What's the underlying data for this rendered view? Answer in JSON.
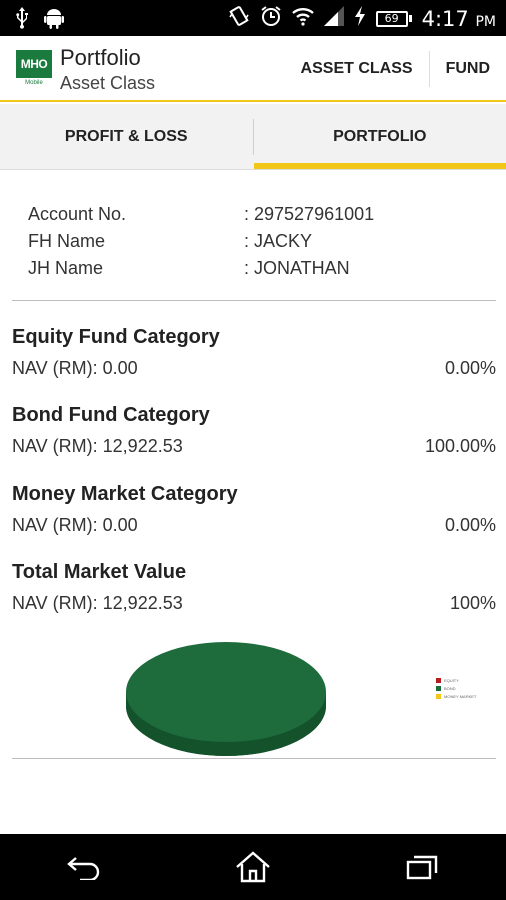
{
  "status_bar": {
    "battery": "69",
    "time": "4:17",
    "ampm": "PM"
  },
  "app_bar": {
    "logo_text": "MHO",
    "logo_subtext": "Mobile",
    "title": "Portfolio",
    "subtitle": "Asset Class",
    "actions": [
      "ASSET CLASS",
      "FUND"
    ]
  },
  "tabs": [
    {
      "label": "PROFIT & LOSS",
      "active": false
    },
    {
      "label": "PORTFOLIO",
      "active": true
    }
  ],
  "account": {
    "rows": [
      {
        "label": "Account No.",
        "value": ": 297527961001"
      },
      {
        "label": "FH Name",
        "value": ": JACKY"
      },
      {
        "label": "JH Name",
        "value": ": JONATHAN"
      }
    ]
  },
  "categories": [
    {
      "title": "Equity Fund Category",
      "nav": "NAV (RM): 0.00",
      "percent": "0.00%"
    },
    {
      "title": "Bond Fund Category",
      "nav": "NAV (RM): 12,922.53",
      "percent": "100.00%"
    },
    {
      "title": "Money Market Category",
      "nav": "NAV (RM): 0.00",
      "percent": "0.00%"
    },
    {
      "title": "Total Market Value",
      "nav": "NAV (RM): 12,922.53",
      "percent": "100%"
    }
  ],
  "chart_legend": [
    {
      "label": "EQUITY",
      "color": "#b71c1c"
    },
    {
      "label": "BOND",
      "color": "#1b6e3a"
    },
    {
      "label": "MONEY MARKET",
      "color": "#f3c61a"
    }
  ],
  "colors": {
    "accent": "#f3c61a",
    "brand_green": "#1b7a3d",
    "pie_green": "#1e6b3c"
  },
  "icons": {
    "status_left": [
      "usb-icon",
      "android-icon"
    ],
    "status_right": [
      "vibrate-icon",
      "alarm-icon",
      "wifi-icon",
      "signal-icon",
      "charging-icon",
      "battery-icon"
    ],
    "nav": [
      "back-icon",
      "home-icon",
      "recent-apps-icon"
    ]
  }
}
